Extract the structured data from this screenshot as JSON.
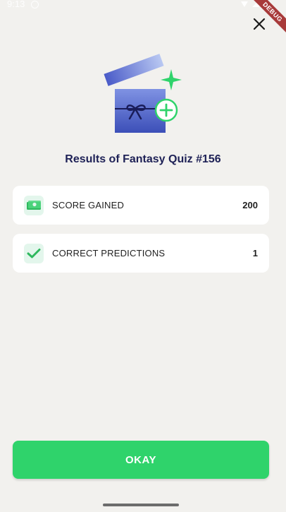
{
  "status_bar": {
    "time": "9:13"
  },
  "debug_banner": "DEBUG",
  "header": {
    "close_icon": "close-icon"
  },
  "hero": {
    "icon": "gift-box-icon"
  },
  "title": "Results of Fantasy Quiz #156",
  "results": [
    {
      "icon": "money-bill-icon",
      "label": "SCORE GAINED",
      "value": "200"
    },
    {
      "icon": "check-icon",
      "label": "CORRECT PREDICTIONS",
      "value": "1"
    }
  ],
  "okay_button": {
    "label": "OKAY"
  },
  "colors": {
    "background": "#f2f1ee",
    "accent_green": "#2fd36b",
    "title_navy": "#1e2156",
    "gift_blue": "#5b6fd6"
  }
}
